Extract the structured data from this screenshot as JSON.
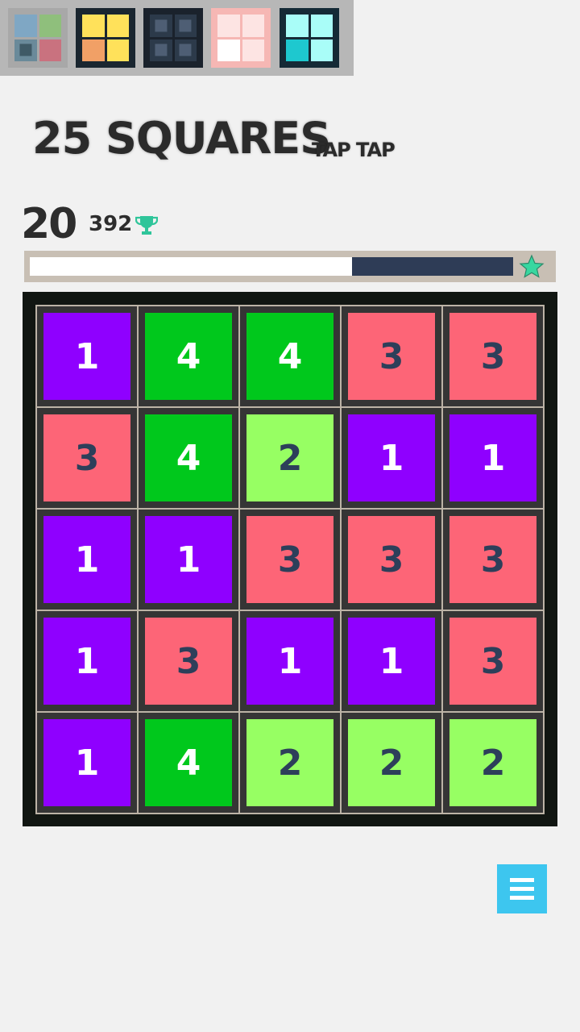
{
  "header": {
    "title": "25 SQUARES",
    "subtitle": "TAP TAP"
  },
  "themes": [
    {
      "name": "theme-pastel",
      "bg": "#a8a8a8",
      "colors": [
        "#7fa7c4",
        "#8fbf7c",
        "#6a8a9a",
        "#c9727f"
      ],
      "accent": "#3f5a66"
    },
    {
      "name": "theme-warm",
      "bg": "#1a2630",
      "colors": [
        "#ffe15a",
        "#ffe15a",
        "#f1a066",
        "#ffe15a"
      ]
    },
    {
      "name": "theme-dark",
      "bg": "#1a222c",
      "colors": [
        "#2c3a4a",
        "#2c3a4a",
        "#2c3a4a",
        "#2c3a4a"
      ],
      "accent": "#4e5e74"
    },
    {
      "name": "theme-pink",
      "bg": "#f6b7b4",
      "colors": [
        "#fde4e3",
        "#fde4e3",
        "#ffffff",
        "#fde4e3"
      ]
    },
    {
      "name": "theme-cyan",
      "bg": "#152a36",
      "colors": [
        "#a9fdf8",
        "#a9fdf8",
        "#1ec8cf",
        "#a9fdf8"
      ]
    }
  ],
  "score": {
    "current": "20",
    "best": "392"
  },
  "progress": {
    "fraction": 0.667,
    "fill_color": "#ffffff",
    "track_color": "#2e3c56",
    "star_color": "#38d7a0"
  },
  "board": {
    "colors": {
      "1": {
        "bg": "#8f00ff",
        "fg": "#ffffff"
      },
      "2": {
        "bg": "#97ff63",
        "fg": "#2d3f5a"
      },
      "3": {
        "bg": "#fd6577",
        "fg": "#2d3f5a"
      },
      "4": {
        "bg": "#00c81c",
        "fg": "#ffffff"
      }
    },
    "rows": [
      [
        "1",
        "4",
        "4",
        "3",
        "3"
      ],
      [
        "3",
        "4",
        "2",
        "1",
        "1"
      ],
      [
        "1",
        "1",
        "3",
        "3",
        "3"
      ],
      [
        "1",
        "3",
        "1",
        "1",
        "3"
      ],
      [
        "1",
        "4",
        "2",
        "2",
        "2"
      ]
    ]
  },
  "menu": {
    "icon": "hamburger-menu-icon",
    "color": "#3dc6ef"
  }
}
